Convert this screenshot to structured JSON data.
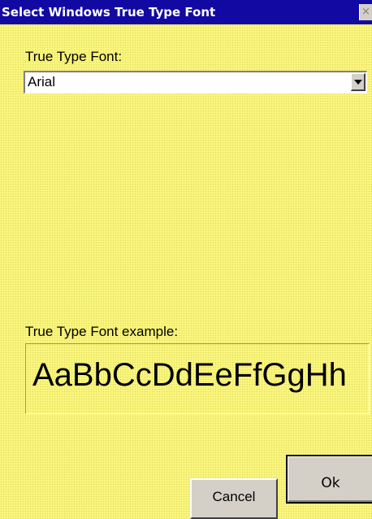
{
  "window": {
    "title": "Select Windows True Type Font",
    "close_glyph": "×"
  },
  "font_select": {
    "label": "True Type Font:",
    "value": "Arial"
  },
  "preview": {
    "label": "True Type Font example:",
    "sample_text": "AaBbCcDdEeFfGgHh"
  },
  "buttons": {
    "cancel_label": "Cancel",
    "ok_label": "Ok"
  },
  "colors": {
    "titlebar": "#1208a2",
    "background": "#fbf77e",
    "button_face": "#d4d0c8"
  },
  "icons": {
    "close": "close-icon",
    "dropdown": "chevron-down-icon"
  }
}
